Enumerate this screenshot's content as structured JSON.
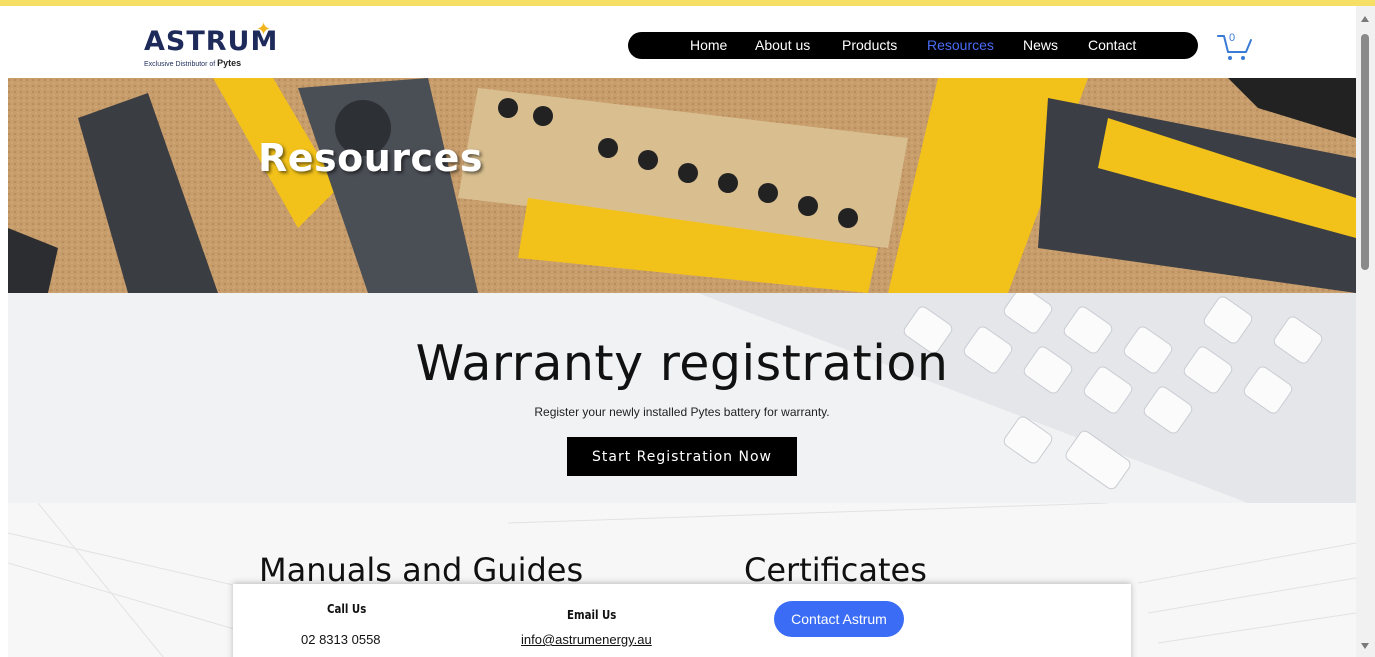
{
  "brand": {
    "name": "ASTRUM",
    "tagline": "Exclusive Distributor of",
    "partner": "Pytes"
  },
  "nav": {
    "items": [
      {
        "label": "Home"
      },
      {
        "label": "About us"
      },
      {
        "label": "Products"
      },
      {
        "label": "Resources",
        "active": true
      },
      {
        "label": "News"
      },
      {
        "label": "Contact"
      }
    ]
  },
  "cart": {
    "count": "0"
  },
  "hero": {
    "title": "Resources"
  },
  "warranty": {
    "title": "Warranty registration",
    "subtitle": "Register your newly installed Pytes battery for warranty.",
    "button_label": "Start Registration Now"
  },
  "sections": {
    "manuals_title": "Manuals and Guides",
    "certificates_title": "Certificates"
  },
  "contact": {
    "call_heading": "Call Us",
    "phone": "02 8313 0558",
    "email_heading": "Email Us",
    "email": "info@astrumenergy.au",
    "button_label": "Contact Astrum"
  },
  "colors": {
    "top_strip": "#f7de64",
    "nav_bg": "#000000",
    "active_link": "#4a6cf7",
    "contact_button": "#3b6cf6",
    "brand_navy": "#1d2a5a",
    "tool_yellow": "#f2c21a"
  }
}
